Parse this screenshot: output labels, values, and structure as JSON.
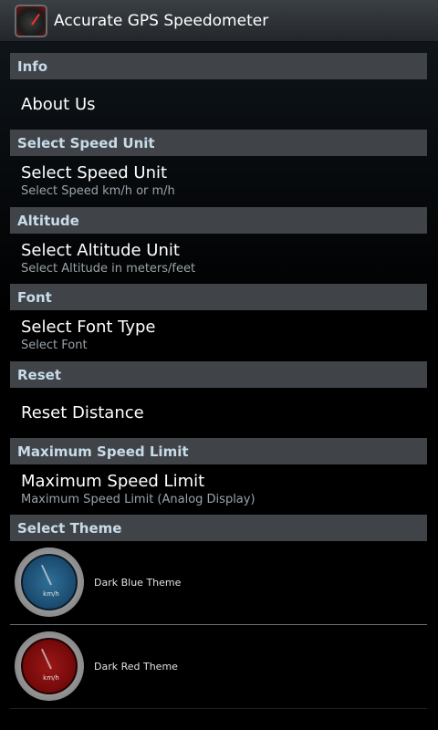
{
  "app": {
    "title": "Accurate GPS Speedometer",
    "app_icon": "speedometer-icon"
  },
  "sections": {
    "info": {
      "header": "Info",
      "item": {
        "title": "About Us"
      }
    },
    "speed_unit": {
      "header": "Select Speed Unit",
      "item": {
        "title": "Select Speed Unit",
        "subtitle": "Select Speed km/h or m/h"
      }
    },
    "altitude": {
      "header": "Altitude",
      "item": {
        "title": "Select Altitude Unit",
        "subtitle": "Select Altitude in meters/feet"
      }
    },
    "font": {
      "header": "Font",
      "item": {
        "title": "Select Font Type",
        "subtitle": "Select Font"
      }
    },
    "reset": {
      "header": "Reset",
      "item": {
        "title": "Reset Distance"
      }
    },
    "max_speed": {
      "header": "Maximum Speed Limit",
      "item": {
        "title": "Maximum Speed Limit",
        "subtitle": "Maximum Speed Limit (Analog Display)"
      }
    },
    "theme": {
      "header": "Select Theme",
      "options": [
        {
          "label": "Dark Blue Theme",
          "gauge_unit": "km/h",
          "color": "#1d4f73"
        },
        {
          "label": "Dark Red Theme",
          "gauge_unit": "km/h",
          "color": "#7a0b0b"
        }
      ]
    }
  }
}
